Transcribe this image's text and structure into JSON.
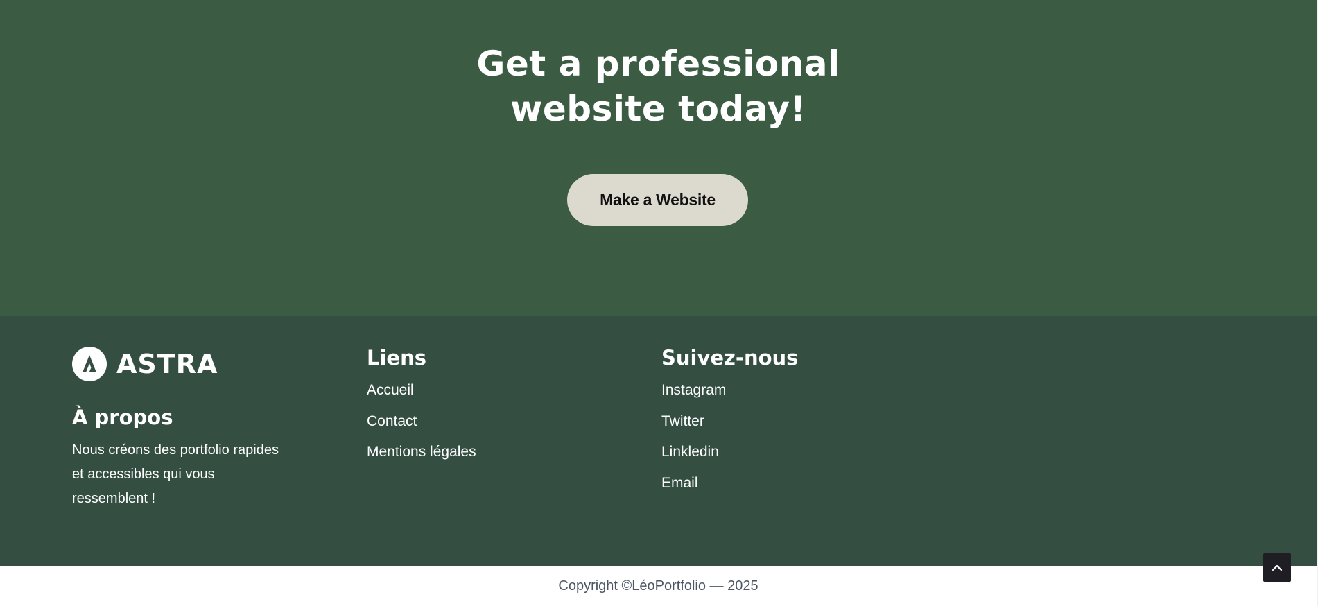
{
  "cta": {
    "title_line1": "Get a professional",
    "title_line2": "website today!",
    "button_label": "Make a Website"
  },
  "footer": {
    "logo_text": "ASTRA",
    "about": {
      "heading": "À propos",
      "text": "Nous créons des portfolio rapides et accessibles qui vous ressemblent !"
    },
    "links": {
      "heading": "Liens",
      "items": [
        "Accueil",
        "Contact",
        "Mentions légales"
      ]
    },
    "follow": {
      "heading": "Suivez-nous",
      "items": [
        "Instagram",
        "Twitter",
        "Linkledin",
        "Email"
      ]
    }
  },
  "copyright": "Copyright ©LéoPortfolio — 2025",
  "colors": {
    "cta_background": "#3b5b42",
    "footer_background": "#344f42",
    "button_background": "#dcd9ce",
    "scroll_top_background": "#1e1e24"
  },
  "icons": {
    "logo": "astra-logo-icon",
    "scroll_top": "chevron-up-icon"
  }
}
